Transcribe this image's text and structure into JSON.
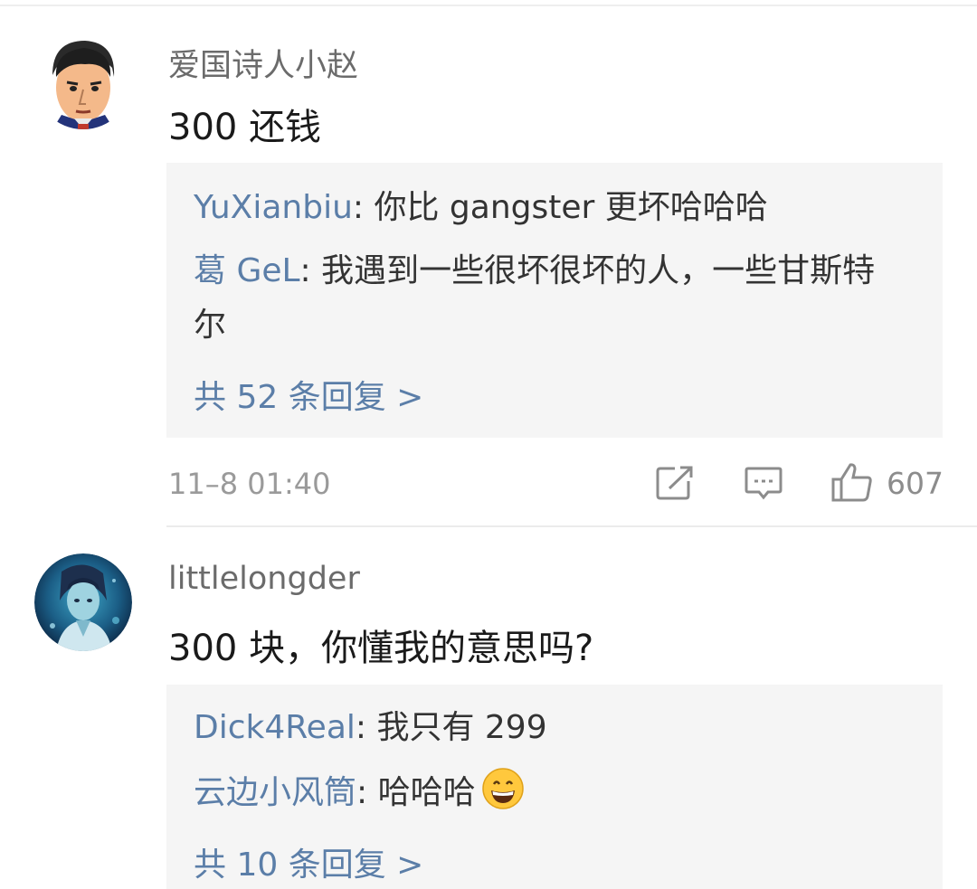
{
  "comments": [
    {
      "username": "爱国诗人小赵",
      "avatar_icon": "cartoon-face-avatar",
      "content": "300 还钱",
      "replies": [
        {
          "user": "YuXianbiu",
          "text": "你比 gangster 更坏哈哈哈"
        },
        {
          "user": "葛 GeL",
          "text": "我遇到一些很坏很坏的人，一些甘斯特尔"
        }
      ],
      "reply_count_label": "共 52 条回复 >",
      "time": "11–8 01:40",
      "like_count": "607"
    },
    {
      "username": "littlelongder",
      "avatar_icon": "anime-character-avatar",
      "content": "300 块，你懂我的意思吗?",
      "replies": [
        {
          "user": "Dick4Real",
          "text": "我只有 299"
        },
        {
          "user": "云边小风筒",
          "text": "哈哈哈",
          "emoji": "grinning-face-emoji"
        }
      ],
      "reply_count_label": "共 10 条回复 >"
    }
  ],
  "separator": ": ",
  "colors": {
    "link_blue": "#5b7ea8",
    "reply_bg": "#f5f5f5",
    "meta_gray": "#9a9a9a"
  }
}
